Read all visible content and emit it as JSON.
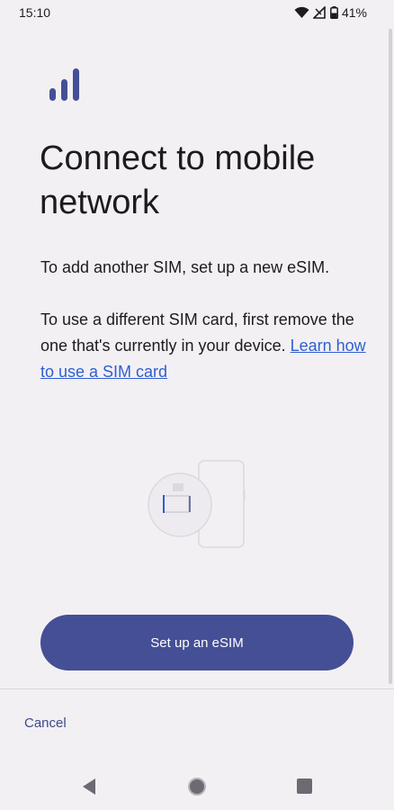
{
  "status_bar": {
    "time": "15:10",
    "battery": "41%",
    "icons": [
      "wifi-icon",
      "cellular-no-signal-icon",
      "battery-icon"
    ]
  },
  "header": {
    "icon": "signal-bars-icon",
    "title": "Connect to mobile network"
  },
  "body": {
    "paragraph1": "To add another SIM, set up a new eSIM.",
    "paragraph2": "To use a different SIM card, first remove the one that's currently in your device.",
    "link": "Learn how to use a SIM card"
  },
  "illustration": {
    "icon": "phone-sim-illustration"
  },
  "actions": {
    "primary": "Set up an eSIM",
    "cancel": "Cancel"
  },
  "nav": {
    "icons": [
      "back-icon",
      "home-icon",
      "recents-icon"
    ]
  },
  "colors": {
    "background": "#f3f0f4",
    "accent": "#454f96",
    "link": "#2f5fd0",
    "cancel_text": "#3d4a8c"
  }
}
